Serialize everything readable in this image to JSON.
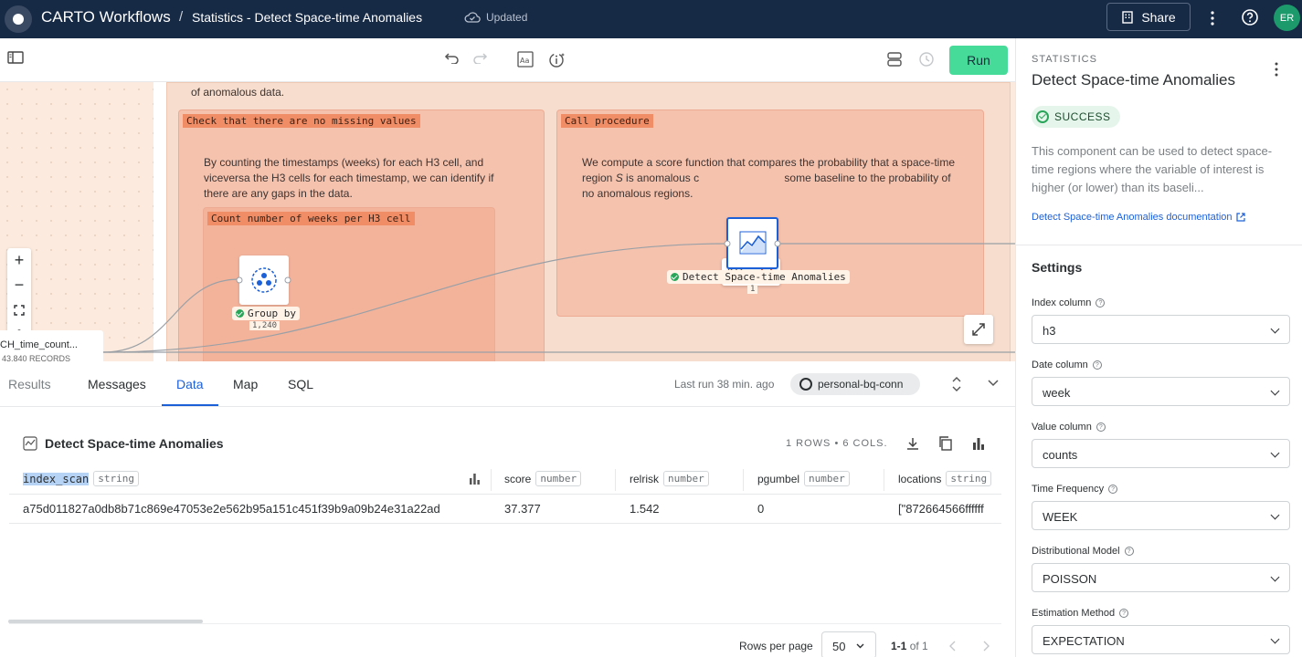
{
  "topbar": {
    "app_title": "CARTO Workflows",
    "separator": "/",
    "workflow_name": "Statistics - Detect Space-time Anomalies",
    "save_status": "Updated",
    "share_label": "Share",
    "avatar_initials": "ER"
  },
  "toolbar": {
    "run_label": "Run"
  },
  "canvas": {
    "intro_text": "of anomalous data.",
    "group_missing": {
      "title": "Check that there are no missing values",
      "description": "By counting the timestamps (weeks) for each H3 cell, and viceversa the H3 cells for each timestamp, we can identify if there are any gaps in the data."
    },
    "group_count": {
      "title": "Count number of weeks per H3 cell"
    },
    "group_procedure": {
      "title": "Call procedure",
      "description_1": "We compute a score function that compares the probability that a space-time region ",
      "description_var": "S",
      "description_2": " is anomalous c",
      "description_3": " some baseline to the probability of no anomalous regions."
    },
    "node_groupby": {
      "label": "Group by",
      "count": "1,240"
    },
    "node_anomalies": {
      "label": "Detect Space-time Anomalies",
      "count": "1"
    },
    "source_node": {
      "label": "CH_time_count...",
      "sub": "43,840 RECORDS"
    }
  },
  "bottom": {
    "tabs": [
      {
        "label": "Results"
      },
      {
        "label": "Messages"
      },
      {
        "label": "Data"
      },
      {
        "label": "Map"
      },
      {
        "label": "SQL"
      }
    ],
    "last_run": "Last run 38 min. ago",
    "connection": "personal-bq-conn",
    "data_title": "Detect Space-time Anomalies",
    "row_summary": "1 ROWS • 6 COLS.",
    "columns": [
      {
        "name": "index_scan",
        "type": "string"
      },
      {
        "name": "score",
        "type": "number"
      },
      {
        "name": "relrisk",
        "type": "number"
      },
      {
        "name": "pgumbel",
        "type": "number"
      },
      {
        "name": "locations",
        "type": "string"
      }
    ],
    "rows": [
      [
        "a75d011827a0db8b71c869e47053e2e562b95a151c451f39b9a09b24e31a22ad",
        "37.377",
        "1.542",
        "0",
        "[\"872664566ffffff"
      ]
    ],
    "rows_per_page_label": "Rows per page",
    "rows_per_page": "50",
    "range_label": "1-1",
    "of_label": "of 1"
  },
  "panel": {
    "category": "STATISTICS",
    "title": "Detect Space-time Anomalies",
    "status": "SUCCESS",
    "description": "This component can be used to detect space-time regions where the variable of interest is higher (or lower) than its baseli...",
    "doc_link": "Detect Space-time Anomalies documentation",
    "settings_title": "Settings",
    "fields": [
      {
        "label": "Index column",
        "value": "h3"
      },
      {
        "label": "Date column",
        "value": "week"
      },
      {
        "label": "Value column",
        "value": "counts"
      },
      {
        "label": "Time Frequency",
        "value": "WEEK"
      },
      {
        "label": "Distributional Model",
        "value": "POISSON"
      },
      {
        "label": "Estimation Method",
        "value": "EXPECTATION"
      }
    ]
  },
  "colors": {
    "topbar_bg": "#162945",
    "run_green": "#47db99",
    "accent_blue": "#1c60d8",
    "group_fill": "#f5c2ae",
    "group_title": "#f08d67",
    "success_green": "#29a559"
  }
}
